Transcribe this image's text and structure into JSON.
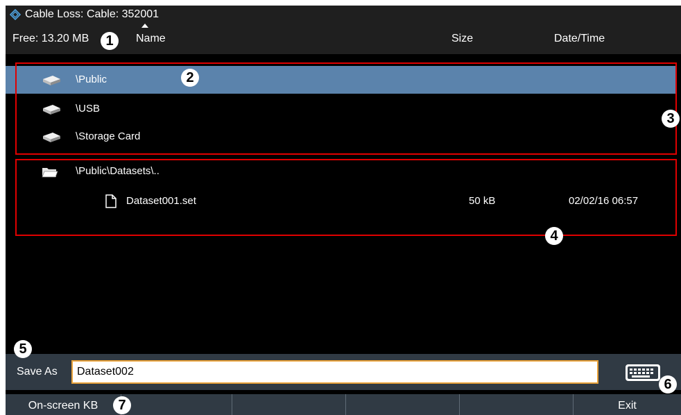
{
  "title": "Cable Loss:  Cable: 352001",
  "header": {
    "free": "Free: 13.20 MB",
    "name_col": "Name",
    "size_col": "Size",
    "date_col": "Date/Time"
  },
  "drives": [
    {
      "name": "\\Public",
      "icon": "drive-icon",
      "selected": true
    },
    {
      "name": "\\USB",
      "icon": "drive-icon"
    },
    {
      "name": "\\Storage Card",
      "icon": "drive-icon"
    }
  ],
  "folder": {
    "name": "\\Public\\Datasets\\..",
    "icon": "folder-icon"
  },
  "files": [
    {
      "name": "Dataset001.set",
      "size": "50 kB",
      "date": "02/02/16 06:57",
      "icon": "file-icon"
    }
  ],
  "save": {
    "label": "Save As",
    "value": "Dataset002"
  },
  "softkeys": [
    "On-screen KB",
    "",
    "",
    "",
    "",
    "Exit"
  ],
  "callouts": [
    "1",
    "2",
    "3",
    "4",
    "5",
    "6",
    "7"
  ],
  "colors": {
    "selected_row": "#5b83ac",
    "callout_box": "#e00000",
    "input_border": "#e8a23a",
    "bar": "#303a44",
    "header": "#1f1f1f"
  }
}
